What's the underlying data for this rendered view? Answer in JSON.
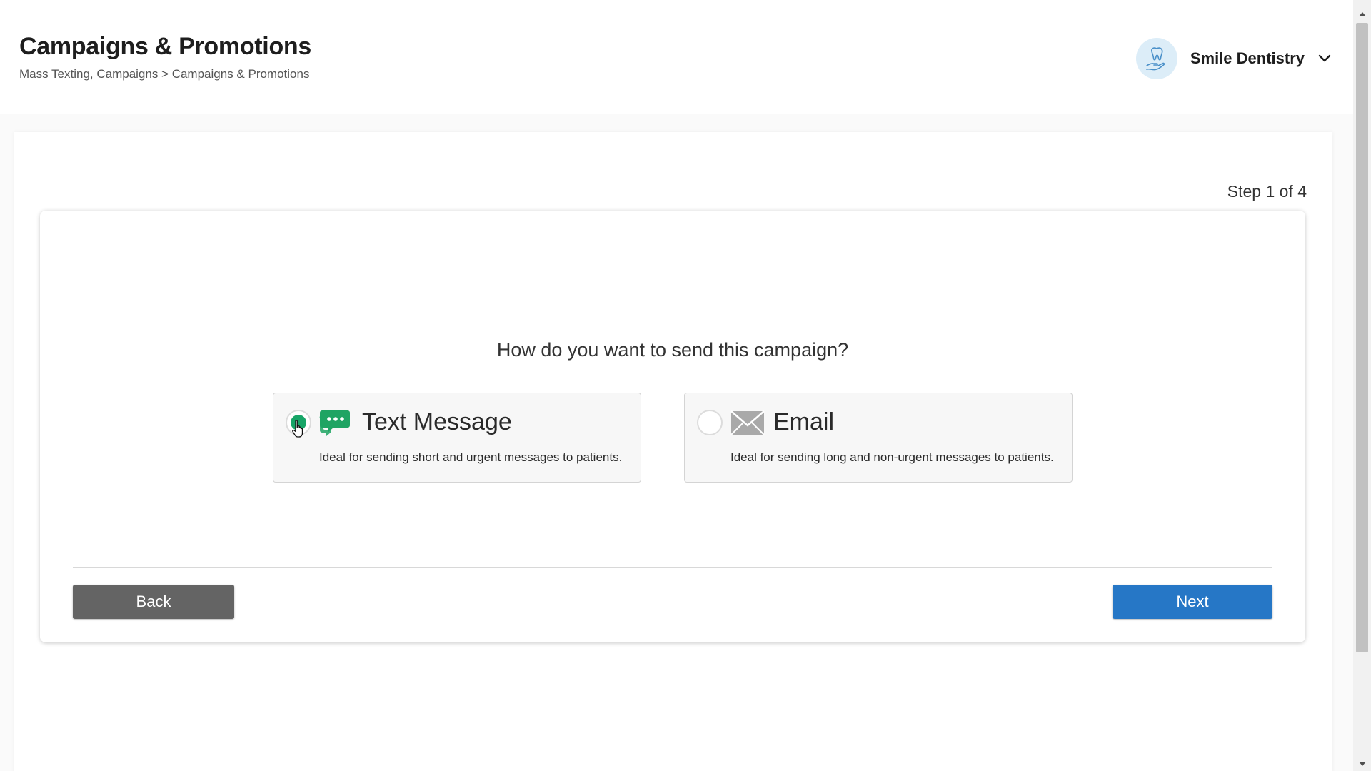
{
  "header": {
    "title": "Campaigns & Promotions",
    "breadcrumb": "Mass Texting, Campaigns > Campaigns & Promotions",
    "practice_name": "Smile Dentistry",
    "avatar_icon": "tooth-in-hand-icon"
  },
  "wizard": {
    "step_label": "Step 1 of 4",
    "question": "How do you want to send this campaign?",
    "options": [
      {
        "title": "Text Message",
        "description": "Ideal for sending short and urgent messages to patients.",
        "icon": "chat-bubbles-icon",
        "selected": true
      },
      {
        "title": "Email",
        "description": "Ideal for sending long and non-urgent messages to patients.",
        "icon": "envelope-icon",
        "selected": false
      }
    ],
    "back_label": "Back",
    "next_label": "Next"
  },
  "colors": {
    "accent_green": "#17a567",
    "primary_blue": "#2677c6",
    "back_gray": "#646464"
  }
}
